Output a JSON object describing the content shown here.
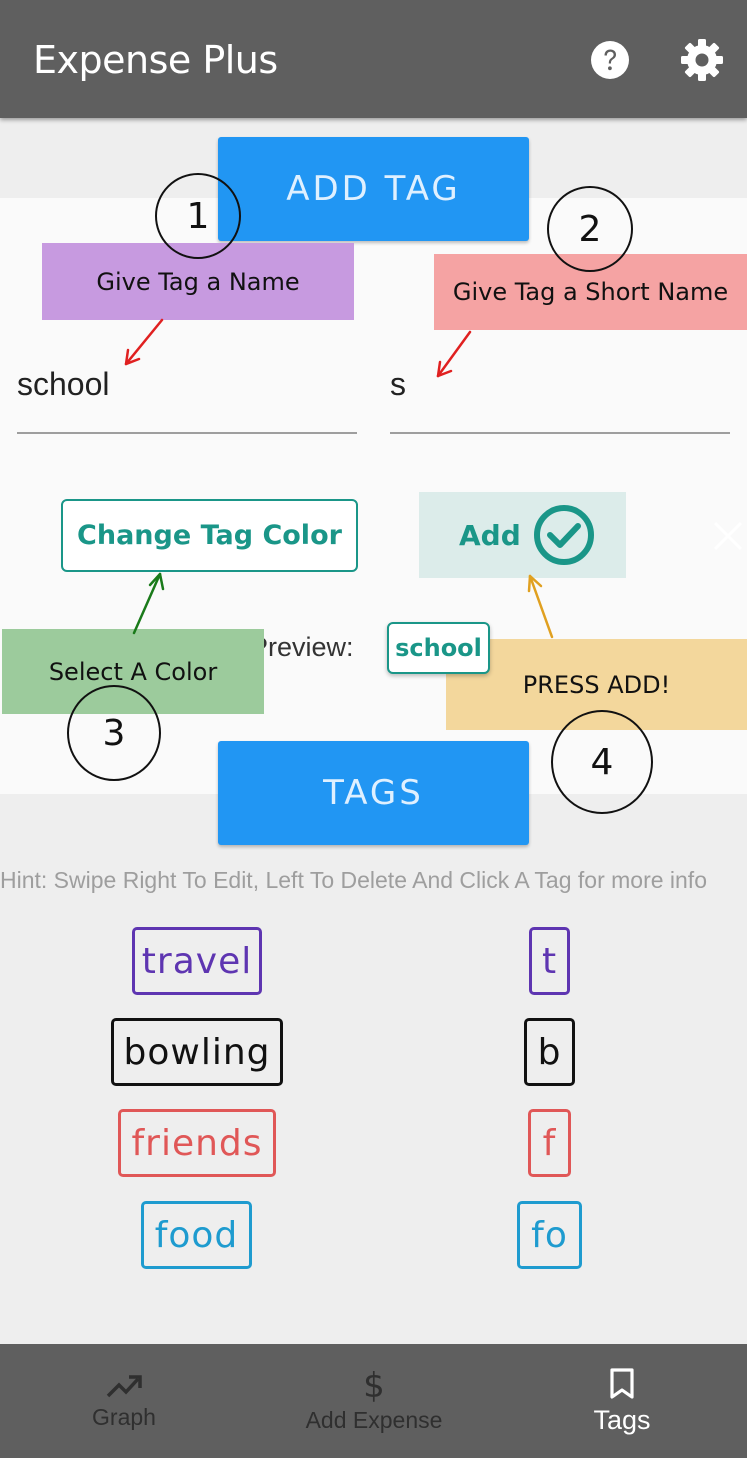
{
  "app_bar": {
    "title": "Expense Plus",
    "help_icon": "help-circle-icon",
    "settings_icon": "gear-icon"
  },
  "add_tag": {
    "header_button": "ADD TAG",
    "name_value": "school",
    "short_name_value": "s",
    "change_color_label": "Change Tag Color",
    "add_label": "Add",
    "preview_label": "Preview:",
    "preview_chip": "school",
    "accent_color": "#1a9688"
  },
  "annotations": {
    "note1": "Give Tag a Name",
    "note2": "Give Tag a  Short Name",
    "note3": "Select A Color",
    "note4": "PRESS ADD!",
    "circle1": "1",
    "circle2": "2",
    "circle3": "3",
    "circle4": "4"
  },
  "tags_section": {
    "header_button": "TAGS",
    "hint": "Hint: Swipe Right To Edit, Left To Delete And Click A Tag for more info",
    "tags": [
      {
        "name": "travel",
        "short": "t",
        "color": "#5e35b1"
      },
      {
        "name": "bowling",
        "short": "b",
        "color": "#111111"
      },
      {
        "name": "friends",
        "short": "f",
        "color": "#e05757"
      },
      {
        "name": "food",
        "short": "fo",
        "color": "#1e9bcf"
      }
    ]
  },
  "bottom_nav": {
    "items": [
      {
        "label": "Graph",
        "icon": "trending-up-icon",
        "active": false
      },
      {
        "label": "Add Expense",
        "icon": "dollar-icon",
        "active": false
      },
      {
        "label": "Tags",
        "icon": "bookmark-icon",
        "active": true
      }
    ]
  }
}
